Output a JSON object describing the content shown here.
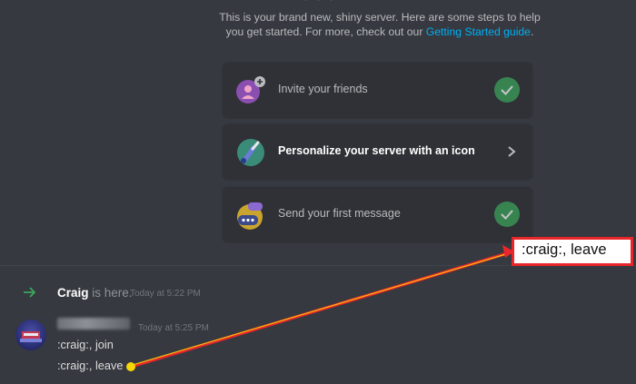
{
  "intro": {
    "text": "This is your brand new, shiny server. Here are some steps to help you get started. For more, check out our ",
    "link": "Getting Started guide",
    "period": "."
  },
  "tasks": [
    {
      "label": "Invite your friends",
      "completed": true,
      "icon": "invite-friends-icon"
    },
    {
      "label": "Personalize your server with an icon",
      "completed": false,
      "icon": "personalize-brush-icon"
    },
    {
      "label": "Send your first message",
      "completed": true,
      "icon": "message-bubble-icon"
    }
  ],
  "join_message": {
    "user": "Craig",
    "text": " is here.",
    "time": "Today at 5:22 PM",
    "icon": "join-arrow-icon"
  },
  "message": {
    "time": "Today at 5:25 PM",
    "lines": [
      ":craig:, join",
      ":craig:, leave"
    ]
  },
  "annotation": {
    "text": ":craig:, leave"
  },
  "colors": {
    "background": "#36393f",
    "card": "#2f3136",
    "link": "#00aff4",
    "check": "#3ba55c",
    "join_arrow": "#3ba55c",
    "annotation_red": "#e8262b",
    "annotation_dot": "#f5d80a"
  }
}
